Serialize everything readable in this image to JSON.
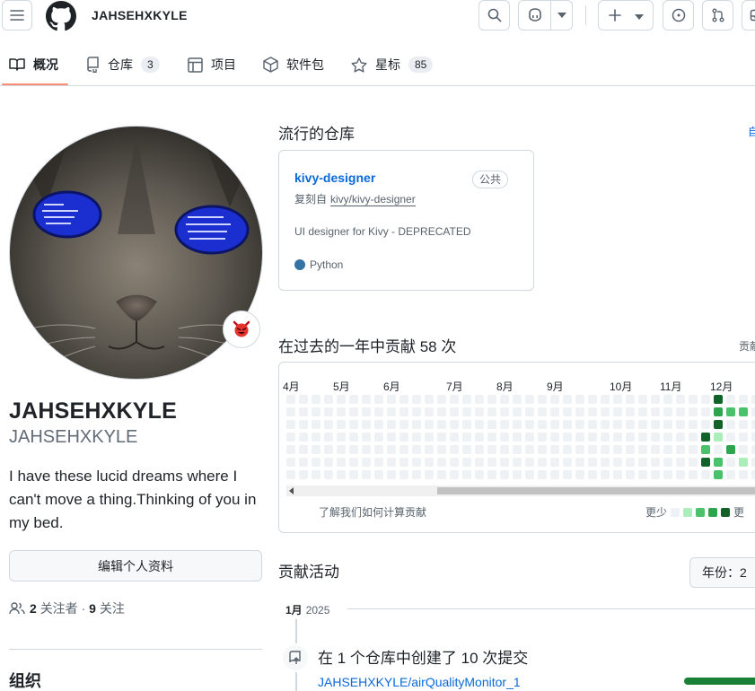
{
  "header": {
    "username": "JAHSEHXKYLE",
    "icons": [
      "menu-icon",
      "github-logo-icon",
      "search-icon",
      "copilot-icon",
      "chevron-down-icon",
      "plus-icon",
      "issues-icon",
      "pull-requests-icon",
      "inbox-icon"
    ]
  },
  "tabs": [
    {
      "label": "概况",
      "icon": "book-icon",
      "selected": true
    },
    {
      "label": "仓库",
      "icon": "repo-icon",
      "count": "3"
    },
    {
      "label": "项目",
      "icon": "table-icon"
    },
    {
      "label": "软件包",
      "icon": "package-icon"
    },
    {
      "label": "星标",
      "icon": "star-icon",
      "count": "85"
    }
  ],
  "profile": {
    "status_emoji": "imp-icon",
    "fullname": "JAHSEHXKYLE",
    "nickname": "JAHSEHXKYLE",
    "bio": "I have these lucid dreams where I can't move a thing.Thinking of you in my bed.",
    "edit_button": "编辑个人资料",
    "followers_count": "2",
    "followers_label": "关注者",
    "separator": "·",
    "following_count": "9",
    "following_label": "关注",
    "organizations_heading": "组织"
  },
  "popular": {
    "title": "流行的仓库",
    "customize": "自",
    "repo": {
      "name": "kivy-designer",
      "visibility": "公共",
      "forked_prefix": "复刻自",
      "forked_from": "kivy/kivy-designer",
      "description": "UI designer for Kivy - DEPRECATED",
      "language": "Python",
      "language_color": "#3572A5"
    }
  },
  "contributions": {
    "title": "在过去的一年中贡献 58 次",
    "settings": "贡献",
    "months": [
      "4月",
      "5月",
      "6月",
      "7月",
      "8月",
      "9月",
      "10月",
      "11月",
      "12月"
    ],
    "learn": "了解我们如何计算贡献",
    "legend_less": "少",
    "legend_prefix": "更",
    "legend_more": "更",
    "legend_colors": [
      "#eff2f5",
      "#aceebb",
      "#4ac26b",
      "#2da44e",
      "#116329"
    ]
  },
  "activity": {
    "title": "贡献活动",
    "year_label": "年份：",
    "year_value": "2",
    "month": "1月",
    "year": "2025",
    "item_title": "在 1 个仓库中创建了 10 次提交",
    "item_repo": "JAHSEHXKYLE/airQualityMonitor_1"
  }
}
